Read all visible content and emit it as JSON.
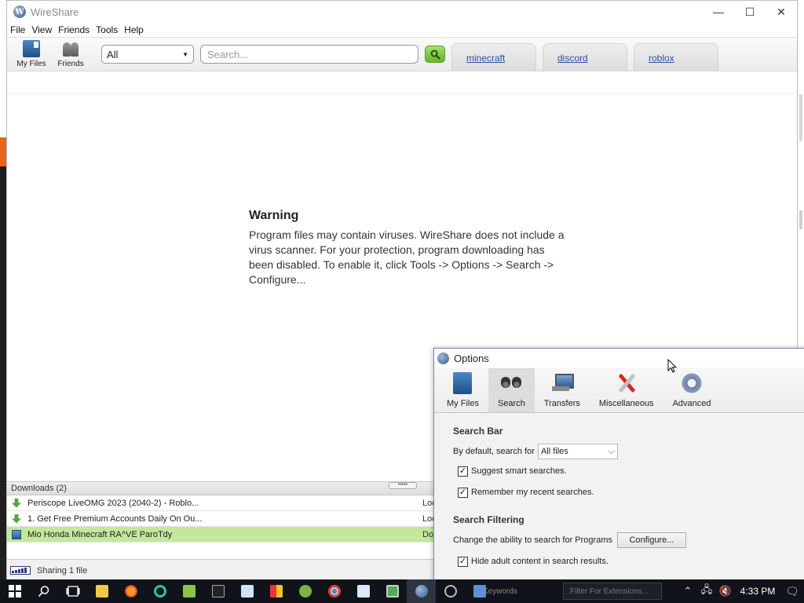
{
  "window": {
    "title": "WireShare",
    "controls": {
      "minimize": "—",
      "maximize": "☐",
      "close": "✕"
    }
  },
  "menu": [
    "File",
    "View",
    "Friends",
    "Tools",
    "Help"
  ],
  "toolbar": {
    "my_files_label": "My Files",
    "friends_label": "Friends",
    "category_selected": "All",
    "search_placeholder": "Search...",
    "search_value": ""
  },
  "search_tabs": [
    "minecraft",
    "discord",
    "roblox"
  ],
  "warning": {
    "title": "Warning",
    "message": "Program files may contain viruses. WireShare does not include a virus scanner. For your protection, program downloading has been disabled. To enable it, click Tools -> Options -> Search -> Configure..."
  },
  "downloads": {
    "header": "Downloads (2)",
    "grip": "•••••",
    "rows": [
      {
        "name": "Periscope LiveOMG 2023 (2040-2) - Roblo...",
        "status": "Loc",
        "icon": "download-arrow-icon",
        "selected": false
      },
      {
        "name": "1. Get Free Premium Accounts Daily On Ou...",
        "status": "Loc",
        "icon": "download-arrow-icon",
        "selected": false
      },
      {
        "name": "Mio Honda Minecraft RA^VE ParoTdy",
        "status": "Dor",
        "icon": "program-file-icon",
        "selected": true
      }
    ]
  },
  "statusbar": {
    "sharing": "Sharing 1 file"
  },
  "options_dialog": {
    "title": "Options",
    "tabs": [
      {
        "label": "My Files",
        "icon": "my-files-icon",
        "active": false
      },
      {
        "label": "Search",
        "icon": "binoculars-icon",
        "active": true
      },
      {
        "label": "Transfers",
        "icon": "transfers-icon",
        "active": false
      },
      {
        "label": "Miscellaneous",
        "icon": "tools-icon",
        "active": false
      },
      {
        "label": "Advanced",
        "icon": "gear-icon",
        "active": false
      }
    ],
    "search_bar": {
      "title": "Search Bar",
      "default_label": "By default, search for",
      "default_value": "All files",
      "suggest_label": "Suggest smart searches.",
      "suggest_checked": true,
      "remember_label": "Remember my recent searches.",
      "remember_checked": true
    },
    "search_filtering": {
      "title": "Search Filtering",
      "programs_label": "Change the ability to search for Programs",
      "configure_label": "Configure...",
      "adult_label": "Hide adult content in search results.",
      "adult_checked": true
    }
  },
  "taskbar": {
    "task_label": "Keywords",
    "task_box": "Filter For Extensions...",
    "clock": "4:33 PM"
  },
  "colors": {
    "selected_row": "#c4e89b",
    "link": "#2a4fa3",
    "search_button": "#66b22d",
    "taskbar": "#10141a"
  }
}
